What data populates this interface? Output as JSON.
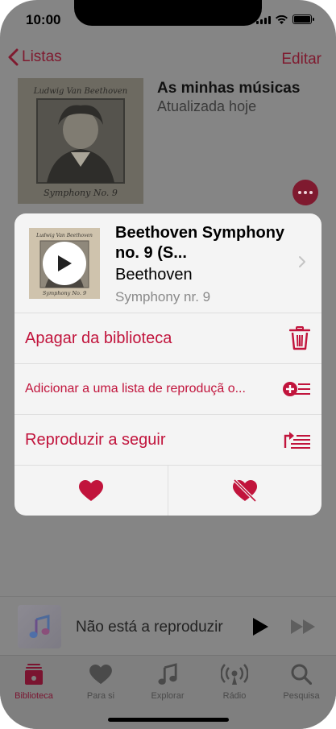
{
  "status_bar": {
    "time": "10:00"
  },
  "nav": {
    "back_label": "Listas",
    "edit_label": "Editar"
  },
  "playlist": {
    "title": "As minhas músicas",
    "subtitle": "Atualizada hoje",
    "art_top_text": "Ludwig Van Beethoven",
    "art_bottom_text": "Symphony No. 9"
  },
  "card": {
    "song_title": "Beethoven Symphony no. 9 (S...",
    "artist": "Beethoven",
    "album": "Symphony nr. 9",
    "art_top_text": "Ludwig Van Beethoven",
    "art_bottom_text": "Symphony No. 9",
    "menu": [
      {
        "label": "Apagar da biblioteca",
        "icon": "trash-icon"
      },
      {
        "label": "Adicionar a uma lista de reproduçã o...",
        "icon": "add-to-playlist-icon"
      },
      {
        "label": "Reproduzir a seguir",
        "icon": "play-next-icon"
      }
    ],
    "love_icon": "heart-icon",
    "dislike_icon": "heart-broken-icon"
  },
  "mini_player": {
    "status": "Não está a reproduzir"
  },
  "tabs": [
    {
      "label": "Biblioteca",
      "icon": "library-icon",
      "active": true
    },
    {
      "label": "Para si",
      "icon": "heart-icon",
      "active": false
    },
    {
      "label": "Explorar",
      "icon": "music-note-icon",
      "active": false
    },
    {
      "label": "Rádio",
      "icon": "radio-icon",
      "active": false
    },
    {
      "label": "Pesquisa",
      "icon": "search-icon",
      "active": false
    }
  ],
  "colors": {
    "accent": "#c1143c",
    "dimmed_accent": "#7f1a2f",
    "overlay": "#858585",
    "card": "#f4f4f4"
  }
}
